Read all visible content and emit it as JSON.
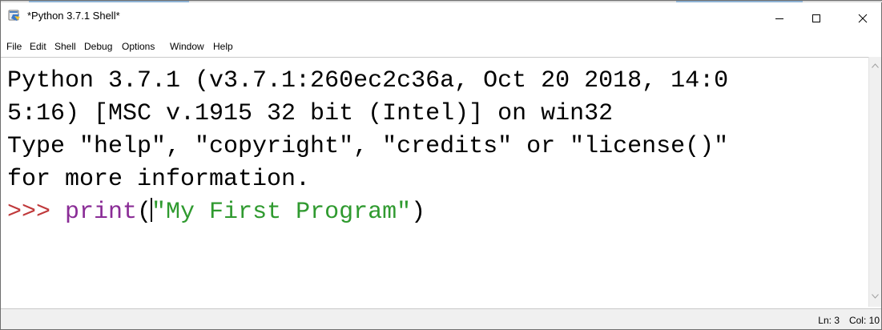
{
  "window": {
    "title": "*Python 3.7.1 Shell*",
    "app_icon": "python-idle-icon",
    "controls": {
      "minimize": "minimize-icon",
      "maximize": "maximize-icon",
      "close": "close-icon"
    }
  },
  "menu": {
    "items": [
      "File",
      "Edit",
      "Shell",
      "Debug",
      "Options",
      "Window",
      "Help"
    ]
  },
  "editor": {
    "lines": [
      "Python 3.7.1 (v3.7.1:260ec2c36a, Oct 20 2018, 14:0",
      "5:16) [MSC v.1915 32 bit (Intel)] on win32",
      "Type \"help\", \"copyright\", \"credits\" or \"license()\"",
      "for more information."
    ],
    "input": {
      "prompt": ">>> ",
      "builtin": "print",
      "open_paren": "(",
      "string": "\"My First Program\"",
      "close_paren": ")"
    }
  },
  "status": {
    "line": "Ln: 3",
    "col": "Col: 10"
  },
  "colors": {
    "prompt": "#c0393b",
    "builtin": "#8a2c96",
    "string": "#2f9a2f",
    "text": "#000000"
  }
}
